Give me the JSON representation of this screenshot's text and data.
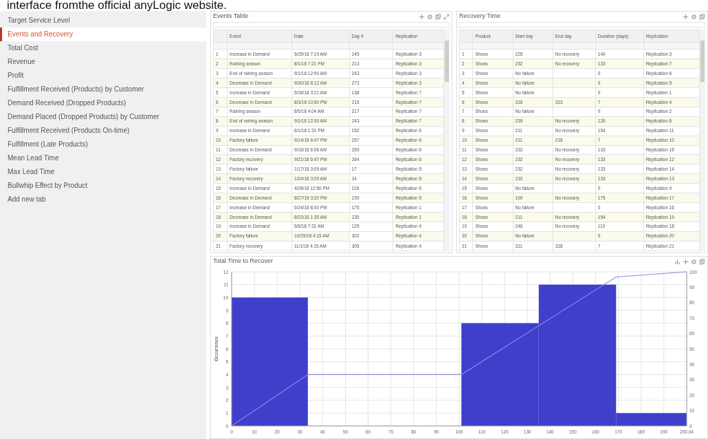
{
  "caption": "interface fromthe official anyLogic website.",
  "sidebar": {
    "items": [
      {
        "label": "Target Service Level",
        "selected": false
      },
      {
        "label": "Events and Recovery",
        "selected": true
      },
      {
        "label": "Total Cost",
        "selected": false
      },
      {
        "label": "Revenue",
        "selected": false
      },
      {
        "label": "Profit",
        "selected": false
      },
      {
        "label": "Fulfillment Received (Products) by Customer",
        "selected": false
      },
      {
        "label": "Demand Received (Dropped Products)",
        "selected": false
      },
      {
        "label": "Demand Placed (Dropped Products) by Customer",
        "selected": false
      },
      {
        "label": "Fulfillment Received (Products On-time)",
        "selected": false
      },
      {
        "label": "Fulfillment (Late Products)",
        "selected": false
      },
      {
        "label": "Mean Lead Time",
        "selected": false
      },
      {
        "label": "Max Lead Time",
        "selected": false
      },
      {
        "label": "Bullwhip Effect by Product",
        "selected": false
      },
      {
        "label": "Add new tab",
        "selected": false
      }
    ]
  },
  "events_table": {
    "title": "Events Table",
    "columns": [
      "",
      "Event",
      "Date",
      "Day #",
      "Replication"
    ],
    "rows": [
      [
        "1",
        "Increase in Demand",
        "5/25/18 7:19 AM",
        "145",
        "Replication 3"
      ],
      [
        "2",
        "Raining season",
        "8/1/18 7:21 PM",
        "213",
        "Replication 3"
      ],
      [
        "3",
        "End of raining season",
        "9/1/18 12:00 AM",
        "243",
        "Replication 3"
      ],
      [
        "4",
        "Decrease in Demand",
        "9/30/18 8:12 AM",
        "273",
        "Replication 3"
      ],
      [
        "5",
        "Increase in Demand",
        "5/18/18 3:21 AM",
        "138",
        "Replication 7"
      ],
      [
        "6",
        "Decrease in Demand",
        "8/3/18 10:50 PM",
        "215",
        "Replication 7"
      ],
      [
        "7",
        "Raining season",
        "8/5/18 4:04 AM",
        "217",
        "Replication 7"
      ],
      [
        "8",
        "End of raining season",
        "9/1/18 12:00 AM",
        "243",
        "Replication 7"
      ],
      [
        "9",
        "Increase in Demand",
        "6/1/18 1:31 PM",
        "152",
        "Replication 6"
      ],
      [
        "10",
        "Factory failure",
        "9/14/18 6:47 PM",
        "257",
        "Replication 6"
      ],
      [
        "11",
        "Decrease in Demand",
        "9/16/18 6:06 AM",
        "259",
        "Replication 6"
      ],
      [
        "12",
        "Factory recovery",
        "9/21/18 6:47 PM",
        "264",
        "Replication 6"
      ],
      [
        "13",
        "Factory failure",
        "1/17/18 3:09 AM",
        "17",
        "Replication 5"
      ],
      [
        "14",
        "Factory recovery",
        "1/24/18 3:09 AM",
        "24",
        "Replication 5"
      ],
      [
        "15",
        "Increase in Demand",
        "4/28/18 12:50 PM",
        "118",
        "Replication 5"
      ],
      [
        "16",
        "Decrease in Demand",
        "8/27/18 3:20 PM",
        "239",
        "Replication 5"
      ],
      [
        "17",
        "Increase in Demand",
        "6/24/18 8:00 PM",
        "175",
        "Replication 1"
      ],
      [
        "18",
        "Decrease in Demand",
        "8/23/18 1:35 AM",
        "235",
        "Replication 1"
      ],
      [
        "19",
        "Increase in Demand",
        "5/5/18 7:31 AM",
        "125",
        "Replication 4"
      ],
      [
        "20",
        "Factory failure",
        "10/29/18 4:15 AM",
        "302",
        "Replication 4"
      ],
      [
        "21",
        "Factory recovery",
        "11/1/18 4:15 AM",
        "305",
        "Replication 4"
      ]
    ]
  },
  "recovery_table": {
    "title": "Recovery Time",
    "columns": [
      "",
      "Product",
      "Start day",
      "End day",
      "Duration (days)",
      "Replication"
    ],
    "rows": [
      [
        "1",
        "Shoes",
        "225",
        "No recovery",
        "140",
        "Replication 3"
      ],
      [
        "2",
        "Shoes",
        "232",
        "No recovery",
        "133",
        "Replication 7"
      ],
      [
        "3",
        "Shoes",
        "No failure",
        null,
        "0",
        "Replication 6"
      ],
      [
        "4",
        "Shoes",
        "No failure",
        null,
        "0",
        "Replication 5"
      ],
      [
        "5",
        "Shoes",
        "No failure",
        null,
        "0",
        "Replication 1"
      ],
      [
        "6",
        "Shoes",
        "316",
        "323",
        "7",
        "Replication 4"
      ],
      [
        "7",
        "Shoes",
        "No failure",
        null,
        "0",
        "Replication 2"
      ],
      [
        "8",
        "Shoes",
        "239",
        "No recovery",
        "126",
        "Replication 8"
      ],
      [
        "9",
        "Shoes",
        "211",
        "No recovery",
        "154",
        "Replication 11"
      ],
      [
        "10",
        "Shoes",
        "211",
        "218",
        "7",
        "Replication 10"
      ],
      [
        "11",
        "Shoes",
        "232",
        "No recovery",
        "133",
        "Replication 15"
      ],
      [
        "12",
        "Shoes",
        "232",
        "No recovery",
        "133",
        "Replication 12"
      ],
      [
        "13",
        "Shoes",
        "232",
        "No recovery",
        "133",
        "Replication 14"
      ],
      [
        "14",
        "Shoes",
        "232",
        "No recovery",
        "133",
        "Replication 13"
      ],
      [
        "15",
        "Shoes",
        "No failure",
        null,
        "0",
        "Replication 9"
      ],
      [
        "16",
        "Shoes",
        "190",
        "No recovery",
        "175",
        "Replication 17"
      ],
      [
        "17",
        "Shoes",
        "No failure",
        null,
        "0",
        "Replication 16"
      ],
      [
        "18",
        "Shoes",
        "211",
        "No recovery",
        "154",
        "Replication 19"
      ],
      [
        "19",
        "Shoes",
        "246",
        "No recovery",
        "119",
        "Replication 18"
      ],
      [
        "20",
        "Shoes",
        "No failure",
        null,
        "0",
        "Replication 20"
      ],
      [
        "21",
        "Shoes",
        "311",
        "318",
        "7",
        "Replication 21"
      ]
    ]
  },
  "recover_chart": {
    "chart_data": {
      "type": "bar",
      "title": "Total Time to Recover",
      "grid": true,
      "x": [
        16.75,
        67.25,
        118,
        152,
        184.52
      ],
      "series": [
        {
          "name": "Occurrence",
          "color": "#3f3fcc",
          "values": [
            10,
            0,
            8,
            11,
            1
          ]
        },
        {
          "type": "line",
          "color": "#8a8ae0",
          "x": [
            0,
            33.5,
            101,
            169,
            200.04
          ],
          "values": [
            0,
            4,
            4,
            11.6,
            12
          ]
        }
      ],
      "xlim": [
        0,
        200.04
      ],
      "ylim": [
        0,
        12
      ],
      "y2lim": [
        0,
        100
      ],
      "xticks": [
        0,
        10,
        20,
        30,
        40,
        50,
        60,
        70,
        80,
        90,
        100,
        110,
        120,
        130,
        140,
        150,
        160,
        170,
        180,
        190,
        {
          "value": 200.04,
          "label": "200.04"
        }
      ],
      "yticks": [
        0,
        1,
        2,
        3,
        4,
        5,
        6,
        7,
        8,
        9,
        10,
        11,
        12
      ],
      "y2ticks": [
        0,
        10,
        20,
        30,
        40,
        50,
        60,
        70,
        80,
        90,
        100
      ]
    }
  }
}
